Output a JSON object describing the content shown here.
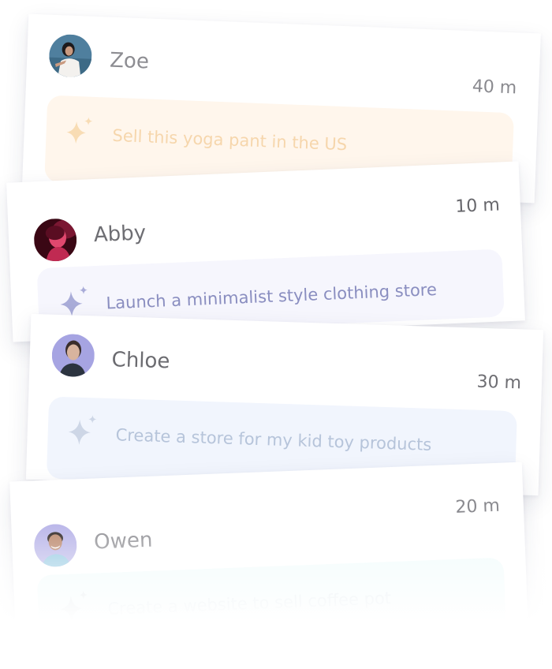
{
  "requests": [
    {
      "name": "Zoe",
      "time": "40 m",
      "prompt": "Sell this yoga pant in the US",
      "accent": "#f6d6ac",
      "icon": "sparkle-icon"
    },
    {
      "name": "Abby",
      "time": "10 m",
      "prompt": "Launch a minimalist style clothing store",
      "accent": "#8a8ec0",
      "icon": "sparkle-icon"
    },
    {
      "name": "Chloe",
      "time": "30 m",
      "prompt": "Create a store for my kid toy products",
      "accent": "#b6c4da",
      "icon": "sparkle-icon"
    },
    {
      "name": "Owen",
      "time": "20 m",
      "prompt": "Create a website to sell coffee pot",
      "accent": "#d8e4ea",
      "icon": "sparkle-icon"
    }
  ]
}
